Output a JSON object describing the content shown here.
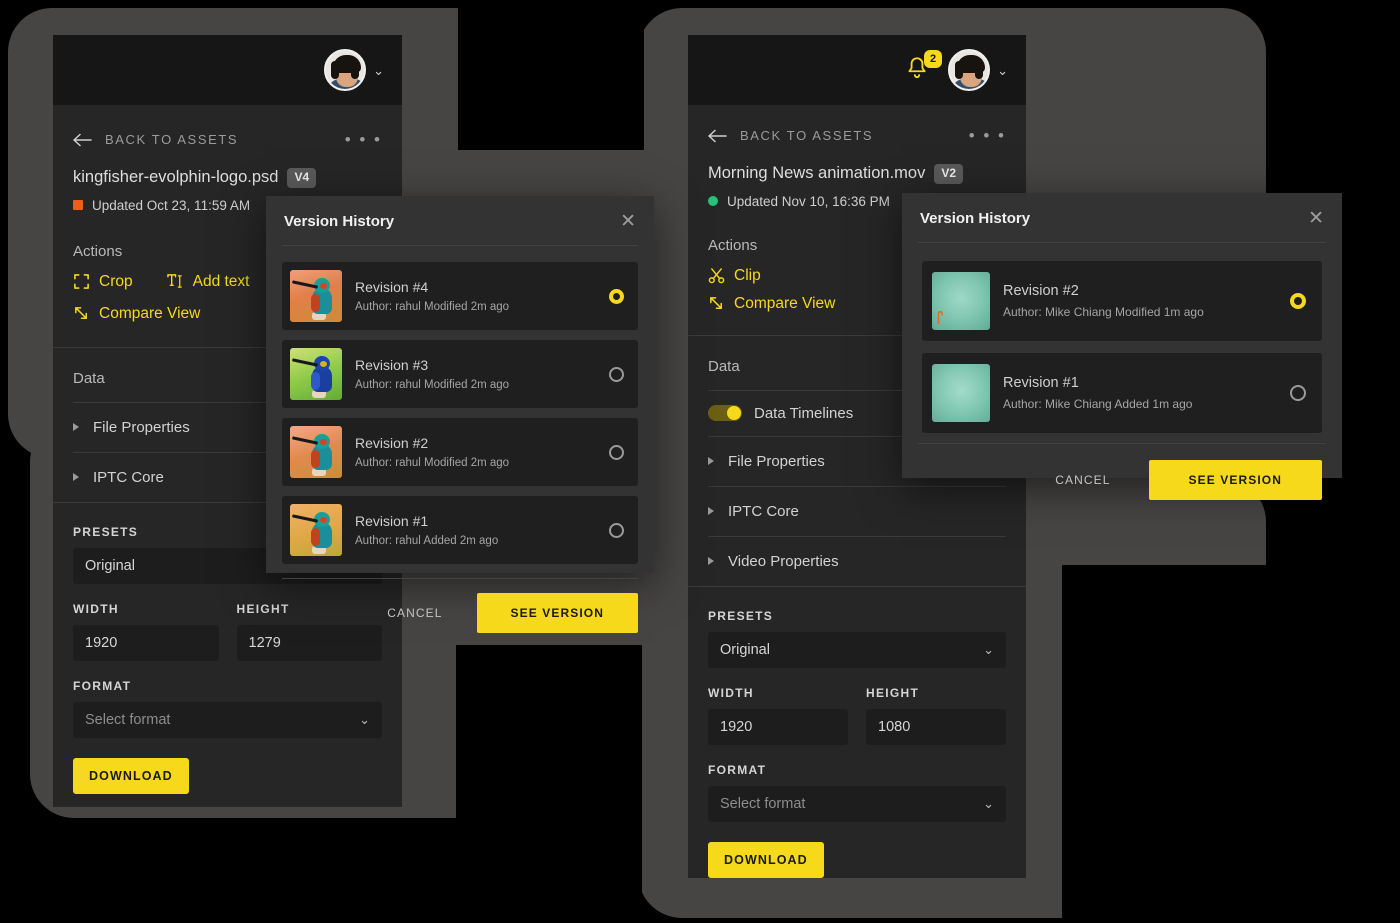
{
  "theme": {
    "accent": "#f5d91a",
    "panel_bg": "#262626",
    "topbar_bg": "#161616",
    "dialog_bg": "#333333",
    "backdrop": "#474544",
    "page_bg": "#000000",
    "status_orange": "#e8601c",
    "status_green": "#27c07a"
  },
  "left_panel": {
    "topbar": {
      "avatar_name": "user-avatar",
      "chevron": "⌄"
    },
    "back": {
      "label": "BACK TO ASSETS",
      "more": "• • •"
    },
    "file": {
      "name": "kingfisher-evolphin-logo.psd",
      "version": "V4"
    },
    "updated": {
      "text": "Updated Oct 23, 11:59 AM",
      "dot_color": "#e8601c",
      "dot_shape": "square"
    },
    "actions": {
      "heading": "Actions",
      "items": [
        {
          "label": "Crop",
          "icon": "crop-icon"
        },
        {
          "label": "Add text",
          "icon": "add-text-icon"
        },
        {
          "label": "Compare View",
          "icon": "compare-view-icon"
        }
      ]
    },
    "data": {
      "heading": "Data",
      "accordions": [
        {
          "label": "File Properties"
        },
        {
          "label": "IPTC Core"
        }
      ]
    },
    "form": {
      "presets_label": "PRESETS",
      "presets_value": "Original",
      "width_label": "WIDTH",
      "width_value": "1920",
      "height_label": "HEIGHT",
      "height_value": "1279",
      "format_label": "FORMAT",
      "format_placeholder": "Select format",
      "download_label": "DOWNLOAD"
    }
  },
  "left_dialog": {
    "title": "Version History",
    "close": "✕",
    "revisions": [
      {
        "title": "Revision #4",
        "meta": "Author: rahul Modified 2m ago",
        "selected": true,
        "thumb": "kingfisher-orange"
      },
      {
        "title": "Revision #3",
        "meta": "Author: rahul Modified 2m ago",
        "selected": false,
        "thumb": "kingfisher-green"
      },
      {
        "title": "Revision #2",
        "meta": "Author: rahul Modified 2m ago",
        "selected": false,
        "thumb": "kingfisher-orange"
      },
      {
        "title": "Revision #1",
        "meta": "Author: rahul Added 2m ago",
        "selected": false,
        "thumb": "kingfisher-yellow"
      }
    ],
    "cancel_label": "CANCEL",
    "confirm_label": "SEE VERSION"
  },
  "right_panel": {
    "topbar": {
      "notification_count": "2",
      "avatar_name": "user-avatar",
      "chevron": "⌄"
    },
    "back": {
      "label": "BACK TO ASSETS",
      "more": "• • •"
    },
    "file": {
      "name": "Morning News animation.mov",
      "version": "V2"
    },
    "updated": {
      "text": "Updated Nov 10, 16:36 PM",
      "dot_color": "#27c07a",
      "dot_shape": "circle"
    },
    "actions": {
      "heading": "Actions",
      "items": [
        {
          "label": "Clip",
          "icon": "scissors-icon"
        },
        {
          "label": "Compare View",
          "icon": "compare-view-icon"
        }
      ]
    },
    "data": {
      "heading": "Data",
      "toggle": {
        "label": "Data Timelines",
        "on": true
      },
      "accordions": [
        {
          "label": "File Properties"
        },
        {
          "label": "IPTC Core"
        },
        {
          "label": "Video Properties"
        }
      ]
    },
    "form": {
      "presets_label": "PRESETS",
      "presets_value": "Original",
      "width_label": "WIDTH",
      "width_value": "1920",
      "height_label": "HEIGHT",
      "height_value": "1080",
      "format_label": "FORMAT",
      "format_placeholder": "Select format",
      "download_label": "DOWNLOAD"
    }
  },
  "right_dialog": {
    "title": "Version History",
    "close": "✕",
    "revisions": [
      {
        "title": "Revision #2",
        "meta": "Author: Mike Chiang Modified 1m ago",
        "selected": true,
        "thumb": "video-teal-mark"
      },
      {
        "title": "Revision #1",
        "meta": "Author: Mike Chiang Added 1m ago",
        "selected": false,
        "thumb": "video-teal"
      }
    ],
    "cancel_label": "CANCEL",
    "confirm_label": "SEE VERSION"
  }
}
